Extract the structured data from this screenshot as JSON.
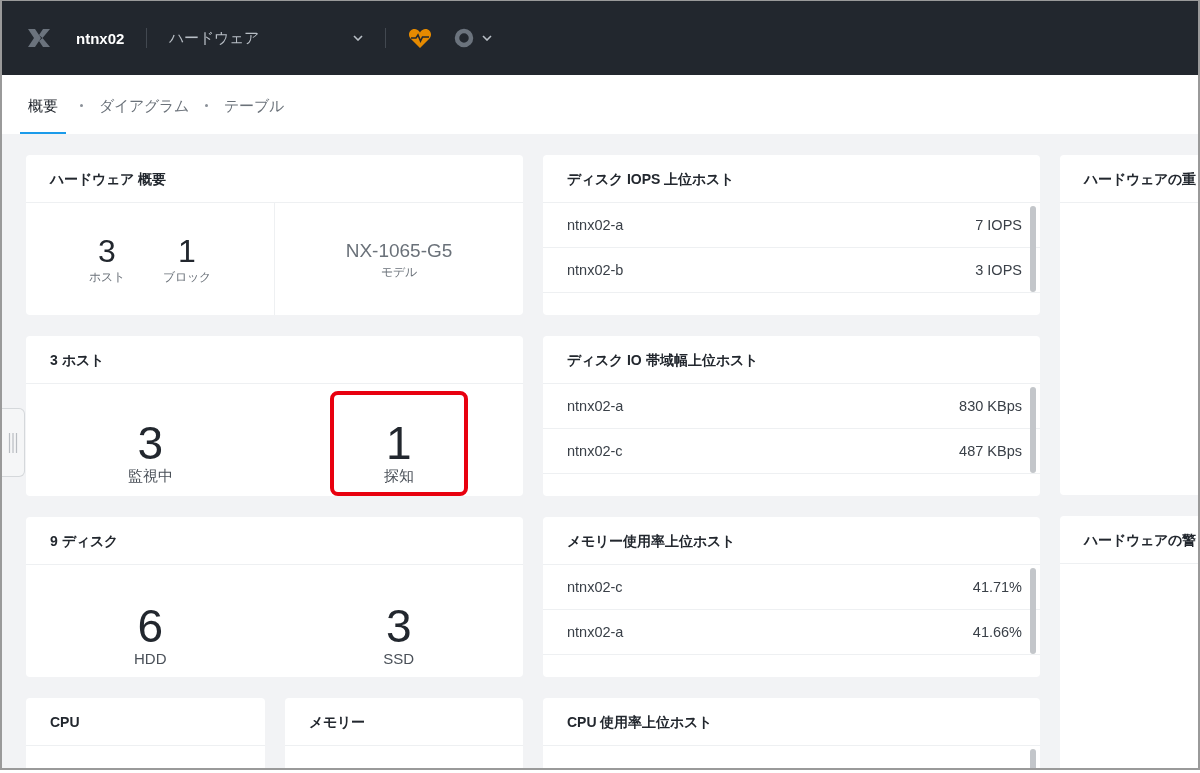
{
  "top_bar": {
    "cluster": "ntnx02",
    "menu": "ハードウェア"
  },
  "tabs": [
    {
      "label": "概要",
      "selected": true
    },
    {
      "label": "ダイアグラム",
      "selected": false
    },
    {
      "label": "テーブル",
      "selected": false
    }
  ],
  "summary": {
    "title": "ハードウェア 概要",
    "stats": [
      {
        "value": "3",
        "label": "ホスト"
      },
      {
        "value": "1",
        "label": "ブロック"
      }
    ],
    "model": {
      "value": "NX-1065-G5",
      "label": "モデル"
    }
  },
  "count_cards": [
    {
      "title": "3 ホスト",
      "stats": [
        {
          "value": "3",
          "label": "監視中",
          "highlighted": false
        },
        {
          "value": "1",
          "label": "探知",
          "highlighted": true
        }
      ]
    },
    {
      "title": "9 ディスク",
      "stats": [
        {
          "value": "6",
          "label": "HDD",
          "highlighted": false
        },
        {
          "value": "3",
          "label": "SSD",
          "highlighted": false
        }
      ]
    }
  ],
  "small_cards": [
    {
      "title": "CPU"
    },
    {
      "title": "メモリー"
    }
  ],
  "top_lists": [
    {
      "title": "ディスク IOPS 上位ホスト",
      "rows": [
        {
          "host": "ntnx02-a",
          "value": "7 IOPS"
        },
        {
          "host": "ntnx02-b",
          "value": "3 IOPS"
        }
      ]
    },
    {
      "title": "ディスク IO 帯域幅上位ホスト",
      "rows": [
        {
          "host": "ntnx02-a",
          "value": "830 KBps"
        },
        {
          "host": "ntnx02-c",
          "value": "487 KBps"
        }
      ]
    },
    {
      "title": "メモリー使用率上位ホスト",
      "rows": [
        {
          "host": "ntnx02-c",
          "value": "41.71%"
        },
        {
          "host": "ntnx02-a",
          "value": "41.66%"
        }
      ]
    },
    {
      "title": "CPU 使用率上位ホスト"
    }
  ],
  "side_cards": [
    {
      "title": "ハードウェアの重"
    },
    {
      "title": "ハードウェアの警"
    }
  ]
}
